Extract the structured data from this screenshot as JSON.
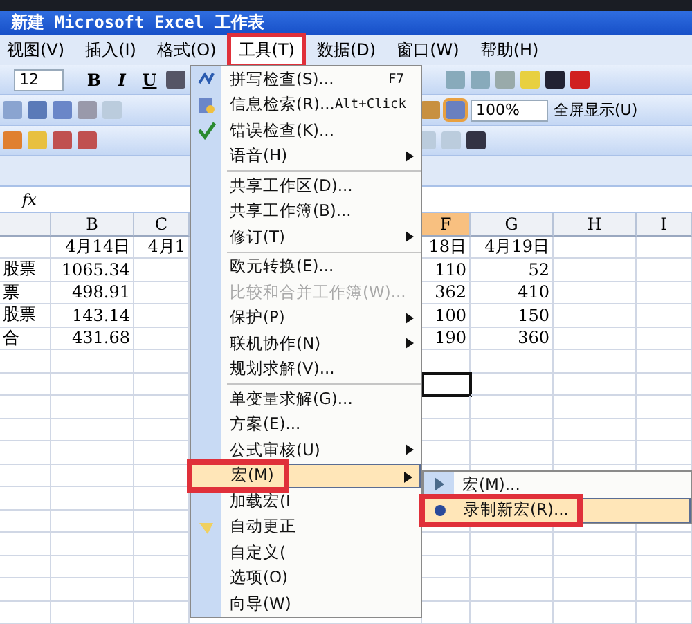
{
  "window": {
    "title": "新建 Microsoft Excel 工作表"
  },
  "menu_bar": [
    {
      "label": "视图(V)",
      "selected": false,
      "marked": false
    },
    {
      "label": "插入(I)",
      "selected": false,
      "marked": false
    },
    {
      "label": "格式(O)",
      "selected": false,
      "marked": false
    },
    {
      "label": "工具(T)",
      "selected": true,
      "marked": true
    },
    {
      "label": "数据(D)",
      "selected": false,
      "marked": false
    },
    {
      "label": "窗口(W)",
      "selected": false,
      "marked": false
    },
    {
      "label": "帮助(H)",
      "selected": false,
      "marked": false
    }
  ],
  "formatting_toolbar": {
    "font_size": "12",
    "style_buttons": [
      "B",
      "I",
      "U"
    ]
  },
  "standard_toolbar": {
    "zoom": "100%",
    "full_screen": "全屏显示(U)"
  },
  "formula_bar": {
    "function_label": "fx"
  },
  "sheet": {
    "columns": [
      {
        "label": "B",
        "selected": false
      },
      {
        "label": "C",
        "selected": false
      },
      {
        "label": "F",
        "selected": true
      },
      {
        "label": "G",
        "selected": false
      },
      {
        "label": "H",
        "selected": false
      },
      {
        "label": "I",
        "selected": false
      }
    ],
    "rows": [
      {
        "active": false,
        "cells": {
          "B": "4月14日",
          "C": "4月1",
          "F": "18日",
          "G": "4月19日"
        }
      },
      {
        "active": false,
        "cells": {
          "A": "股票",
          "B": "1065.34",
          "F": "110",
          "G": "52"
        }
      },
      {
        "active": false,
        "cells": {
          "A": "票",
          "B": "498.91",
          "F": "362",
          "G": "410"
        }
      },
      {
        "active": false,
        "cells": {
          "A": "股票",
          "B": "143.14",
          "F": "100",
          "G": "150"
        }
      },
      {
        "active": false,
        "cells": {
          "A": "合",
          "B": "431.68",
          "F": "190",
          "G": "360"
        }
      },
      {
        "active": false,
        "cells": {}
      },
      {
        "active": true,
        "cells": {}
      }
    ]
  },
  "tools_menu": [
    {
      "kind": "item",
      "label": "拼写检查(S)...",
      "shortcut": "F7",
      "submenu": false,
      "disabled": false,
      "selected": false,
      "marked": false
    },
    {
      "kind": "item",
      "label": "信息检索(R)...",
      "shortcut": "Alt+Click",
      "submenu": false,
      "disabled": false,
      "selected": false,
      "marked": false
    },
    {
      "kind": "item",
      "label": "错误检查(K)...",
      "submenu": false,
      "disabled": false,
      "selected": false,
      "marked": false
    },
    {
      "kind": "item",
      "label": "语音(H)",
      "submenu": true,
      "disabled": false,
      "selected": false,
      "marked": false
    },
    {
      "kind": "separator"
    },
    {
      "kind": "item",
      "label": "共享工作区(D)...",
      "submenu": false,
      "disabled": false,
      "selected": false,
      "marked": false
    },
    {
      "kind": "item",
      "label": "共享工作簿(B)...",
      "submenu": false,
      "disabled": false,
      "selected": false,
      "marked": false
    },
    {
      "kind": "item",
      "label": "修订(T)",
      "submenu": true,
      "disabled": false,
      "selected": false,
      "marked": false
    },
    {
      "kind": "separator"
    },
    {
      "kind": "item",
      "label": "欧元转换(E)...",
      "submenu": false,
      "disabled": false,
      "selected": false,
      "marked": false
    },
    {
      "kind": "item",
      "label": "比较和合并工作簿(W)...",
      "submenu": false,
      "disabled": true,
      "selected": false,
      "marked": false
    },
    {
      "kind": "item",
      "label": "保护(P)",
      "submenu": true,
      "disabled": false,
      "selected": false,
      "marked": false
    },
    {
      "kind": "item",
      "label": "联机协作(N)",
      "submenu": true,
      "disabled": false,
      "selected": false,
      "marked": false
    },
    {
      "kind": "item",
      "label": "规划求解(V)...",
      "submenu": false,
      "disabled": false,
      "selected": false,
      "marked": false
    },
    {
      "kind": "separator"
    },
    {
      "kind": "item",
      "label": "单变量求解(G)...",
      "submenu": false,
      "disabled": false,
      "selected": false,
      "marked": false
    },
    {
      "kind": "item",
      "label": "方案(E)...",
      "submenu": false,
      "disabled": false,
      "selected": false,
      "marked": false
    },
    {
      "kind": "item",
      "label": "公式审核(U)",
      "submenu": true,
      "disabled": false,
      "selected": false,
      "marked": false
    },
    {
      "kind": "item",
      "label": "宏(M)",
      "submenu": true,
      "disabled": false,
      "selected": true,
      "marked": true
    },
    {
      "kind": "item",
      "label": "加载宏(I",
      "submenu": false,
      "disabled": false,
      "selected": false,
      "marked": false
    },
    {
      "kind": "item",
      "label": "自动更正",
      "submenu": false,
      "disabled": false,
      "selected": false,
      "marked": false
    },
    {
      "kind": "item",
      "label": "自定义(",
      "submenu": false,
      "disabled": false,
      "selected": false,
      "marked": false
    },
    {
      "kind": "item",
      "label": "选项(O)",
      "submenu": false,
      "disabled": false,
      "selected": false,
      "marked": false
    },
    {
      "kind": "item",
      "label": "向导(W)",
      "submenu": false,
      "disabled": false,
      "selected": false,
      "marked": false
    }
  ],
  "macro_submenu": [
    {
      "label": "宏(M)...",
      "selected": false,
      "marked": false
    },
    {
      "label": "录制新宏(R)...",
      "selected": true,
      "marked": true
    }
  ]
}
